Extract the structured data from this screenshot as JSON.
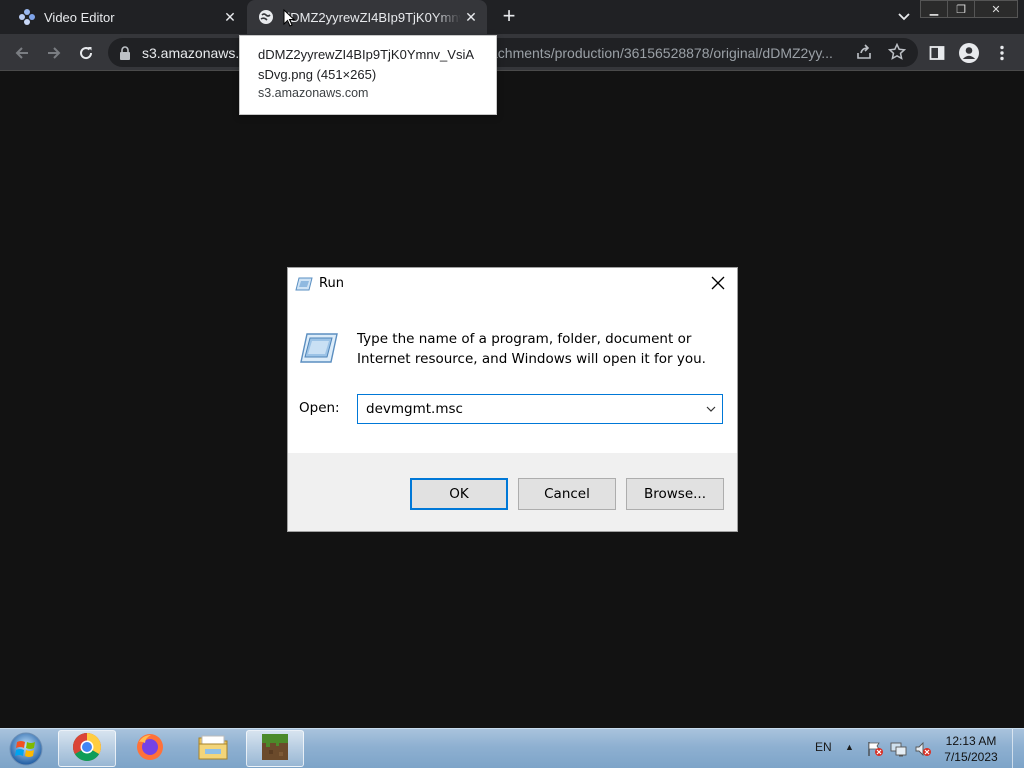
{
  "browser": {
    "tabs": [
      {
        "title": "Video Editor",
        "favicon": "video-editor-icon",
        "active": false
      },
      {
        "title": "dDMZ2yyrewZI4BIp9TjK0Ymnv_VsiAsDvg.png",
        "favicon": "globe-icon",
        "active": true
      }
    ],
    "new_tab_label": "+",
    "address": {
      "host": "s3.amazonaws.com",
      "visible_host": "s3.amazonaws.c",
      "visible_rest": "achments/production/36156528878/original/dDMZ2yy..."
    }
  },
  "tooltip": {
    "title": "dDMZ2yyrewZI4BIp9TjK0Ymnv_VsiAsDvg.png (451×265)",
    "host": "s3.amazonaws.com"
  },
  "run_dialog": {
    "title": "Run",
    "description": "Type the name of a program, folder, document or Internet resource, and Windows will open it for you.",
    "open_label": "Open:",
    "open_value": "devmgmt.msc",
    "buttons": {
      "ok": "OK",
      "cancel": "Cancel",
      "browse": "Browse..."
    }
  },
  "taskbar": {
    "apps": [
      "chrome-icon",
      "firefox-icon",
      "file-explorer-icon",
      "minecraft-icon"
    ],
    "language": "EN",
    "time": "12:13 AM",
    "date": "7/15/2023"
  },
  "colors": {
    "tab_strip": "#202124",
    "toolbar": "#35363a",
    "page_bg": "#121212",
    "accent": "#0078d7"
  }
}
